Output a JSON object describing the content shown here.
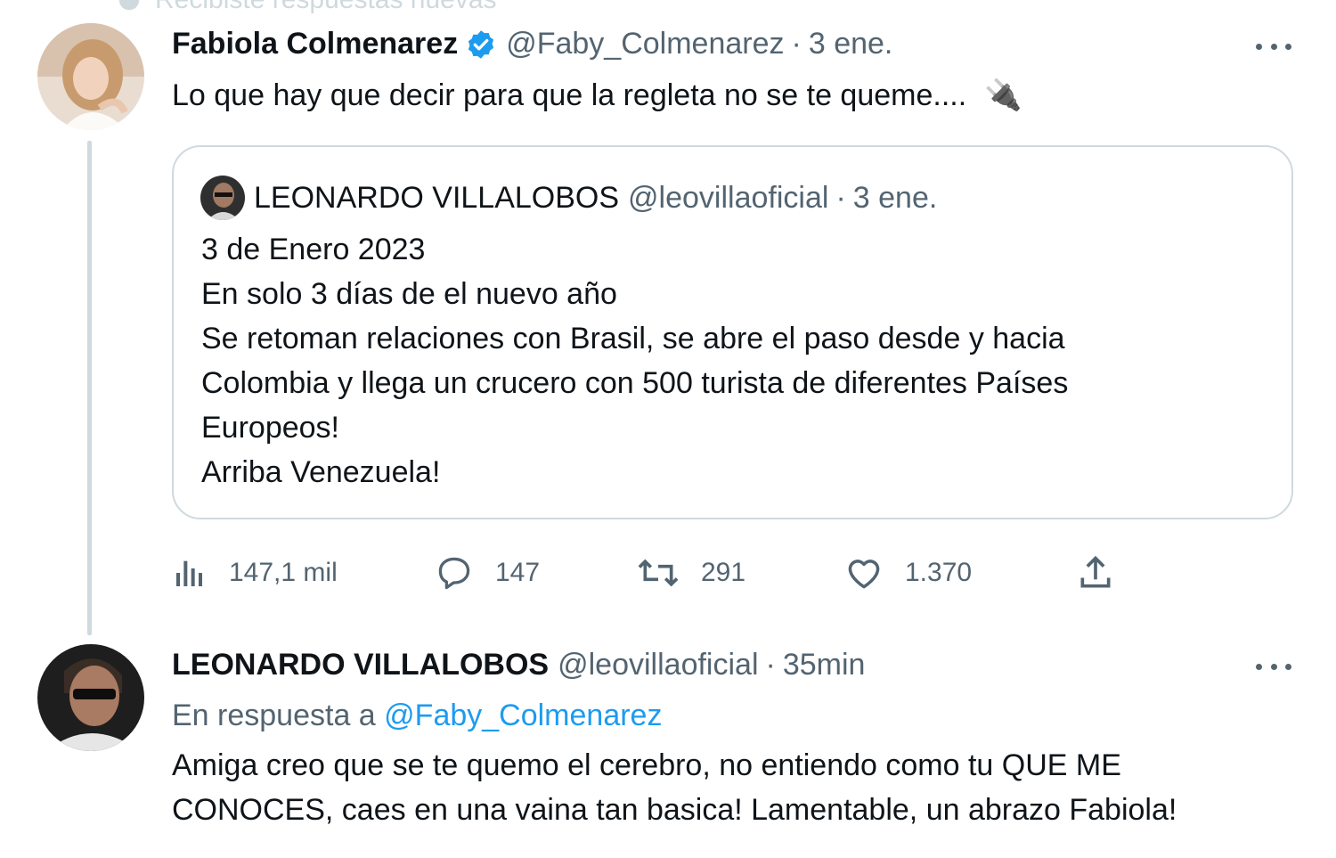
{
  "banner": {
    "text": "Recibiste respuestas nuevas"
  },
  "tweet1": {
    "author_name": "Fabiola Colmenarez",
    "handle": "@Faby_Colmenarez",
    "separator": "·",
    "time": "3 ene.",
    "text": "Lo que hay que decir para que la regleta no se te queme....",
    "emoji": "🔌",
    "verified_icon": "verified-badge-icon",
    "quoted": {
      "author_name": "LEONARDO VILLALOBOS",
      "handle": "@leovillaoficial",
      "separator": "·",
      "time": "3 ene.",
      "lines": [
        "3 de Enero 2023",
        "En solo 3 días de el nuevo año",
        "Se retoman relaciones con Brasil, se abre el paso desde y hacia",
        "Colombia y llega un crucero con 500 turista de diferentes Países",
        "Europeos!",
        "Arriba Venezuela!"
      ]
    },
    "actions": {
      "views": "147,1 mil",
      "replies": "147",
      "retweets": "291",
      "likes": "1.370"
    }
  },
  "tweet2": {
    "author_name": "LEONARDO VILLALOBOS",
    "handle": "@leovillaoficial",
    "separator": "·",
    "time": "35min",
    "reply_prefix": "En respuesta a",
    "reply_mention": "@Faby_Colmenarez",
    "lines": [
      "Amiga creo que se te quemo el cerebro, no entiendo como tu QUE ME",
      "CONOCES, caes en una vaina tan basica! Lamentable, un abrazo Fabiola!"
    ]
  },
  "colors": {
    "text": "#0f1419",
    "secondary": "#536471",
    "accent": "#1d9bf0",
    "border": "#cfd9de"
  }
}
